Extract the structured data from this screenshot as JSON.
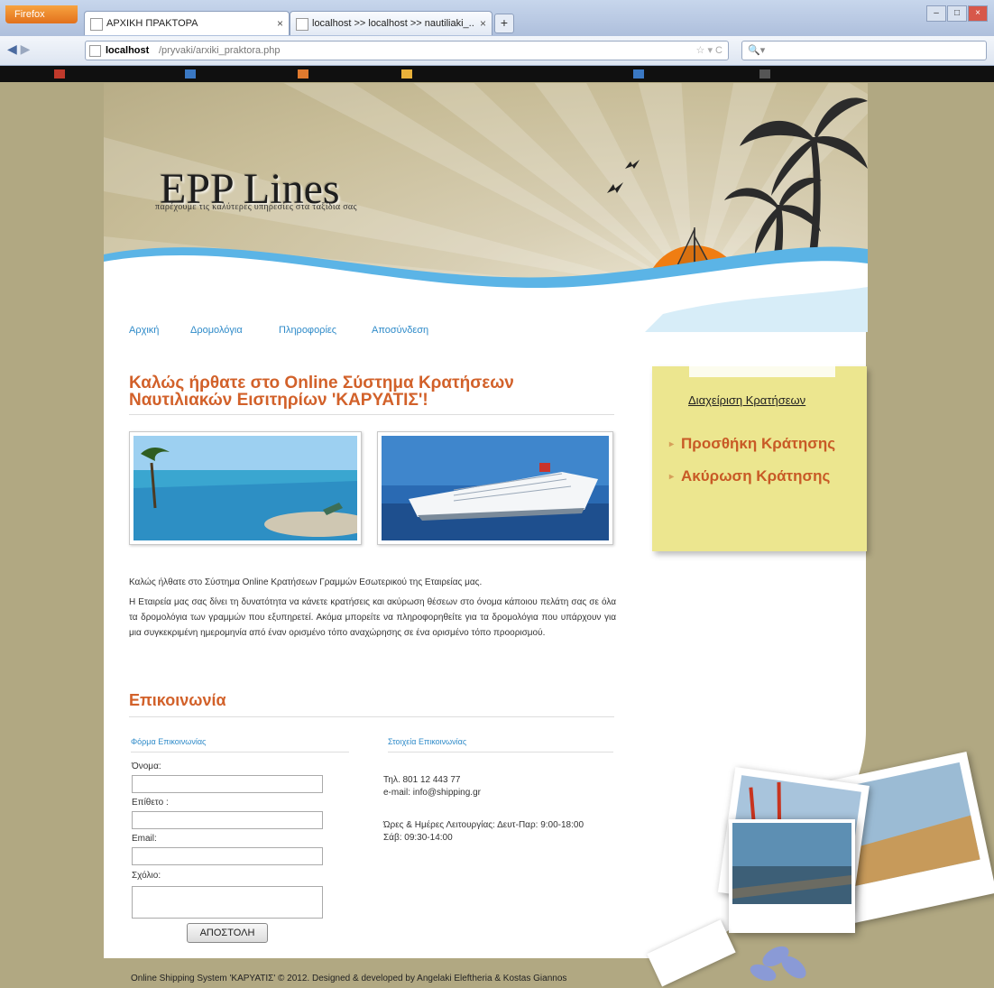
{
  "browser": {
    "firefox_button": "Firefox",
    "tabs": [
      {
        "title": "ΑΡΧΙΚΗ ΠΡΑΚΤΟΡΑ",
        "close": "×"
      },
      {
        "title": "localhost >> localhost >> nautiliaki_...",
        "close": "×"
      }
    ],
    "new_tab": "+",
    "url_host": "localhost",
    "url_path": "/pryvaki/arxiki_praktora.php",
    "search_placeholder": ""
  },
  "header": {
    "logo": "EPP Lines",
    "tagline": "παρέχουμε τις καλύτερες υπηρεσίες στα ταξίδια σας"
  },
  "menu": {
    "items": [
      {
        "label": "Αρχική"
      },
      {
        "label": "Δρομολόγια"
      },
      {
        "label": "Πληροφορίες"
      },
      {
        "label": "Αποσύνδεση"
      }
    ]
  },
  "main": {
    "title": "Καλώς ήρθατε στο Online Σύστημα Κρατήσεων Ναυτιλιακών Εισιτηρίων 'ΚΑΡΥΑΤΙΣ'!",
    "intro_1": "Καλώς ήλθατε στο Σύστημα Online Κρατήσεων Γραμμών Εσωτερικού της Εταιρείας μας.",
    "intro_2": "Η Εταιρεία μας σας δίνει τη δυνατότητα να κάνετε κρατήσεις και ακύρωση θέσεων στο όνομα κάποιου πελάτη σας σε όλα τα δρομολόγια των γραμμών που εξυπηρετεί. Ακόμα μπορείτε να πληροφορηθείτε για τα δρομολόγια που υπάρχουν για μια συγκεκριμένη ημερομηνία από έναν ορισμένο τόπο αναχώρησης σε ένα ορισμένο τόπο προορισμού."
  },
  "contact": {
    "title": "Επικοινωνία",
    "form_title": "Φόρμα Επικοινωνίας",
    "info_title": "Στοιχεία Επικοινωνίας",
    "fields": {
      "name": "Όνομα:",
      "surname": "Επίθετο :",
      "email": "Email:",
      "comment": "Σχόλιο:"
    },
    "send_button": "ΑΠΟΣΤΟΛΗ",
    "phone": "Τηλ. 801 12 443 77",
    "email_line": "e-mail: info@shipping.gr",
    "hours": "Ώρες & Ημέρες Λειτουργίας: Δευτ-Παρ: 9:00-18:00",
    "saturday": "Σάβ: 09:30-14:00"
  },
  "sidebar": {
    "heading": "Διαχείριση Κρατήσεων",
    "items": [
      {
        "label": "Προσθήκη Κράτησης"
      },
      {
        "label": "Ακύρωση Κράτησης"
      }
    ]
  },
  "footer": {
    "text": "Online Shipping System 'ΚΑΡΥΑΤΙΣ' © 2012. Designed & developed by Angelaki Eleftheria & Kostas Giannos"
  },
  "colors": {
    "accent_orange": "#d2612a",
    "link_blue": "#2f8bc9",
    "sidebar_yellow": "#ece68f",
    "page_bg": "#b1a882"
  }
}
